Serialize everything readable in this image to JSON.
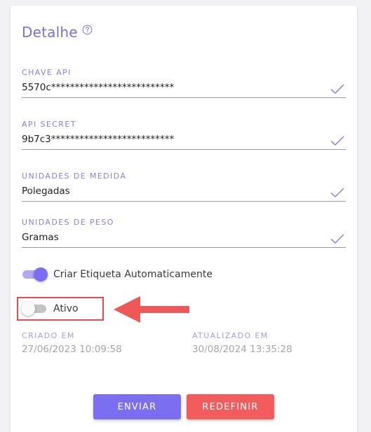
{
  "header": {
    "title": "Detalhe",
    "help_icon": "help-circle-icon"
  },
  "fields": [
    {
      "label": "CHAVE API",
      "value": "5570c**************************"
    },
    {
      "label": "API SECRET",
      "value": "9b7c3**************************"
    },
    {
      "label": "UNIDADES DE MEDIDA",
      "value": "Polegadas"
    },
    {
      "label": "UNIDADES DE PESO",
      "value": "Gramas"
    }
  ],
  "toggles": {
    "auto_label": {
      "label": "Criar Etiqueta Automaticamente",
      "on": true
    },
    "active": {
      "label": "Ativo",
      "on": false
    }
  },
  "meta": {
    "created_label": "CRIADO EM",
    "created_value": "27/06/2023 10:09:58",
    "updated_label": "ATUALIZADO EM",
    "updated_value": "30/08/2024 13:35:28"
  },
  "buttons": {
    "send": "ENVIAR",
    "reset": "REDEFINIR"
  },
  "colors": {
    "accent": "#7b6ef0",
    "danger": "#f25c5c",
    "annotation": "#e8494a"
  }
}
